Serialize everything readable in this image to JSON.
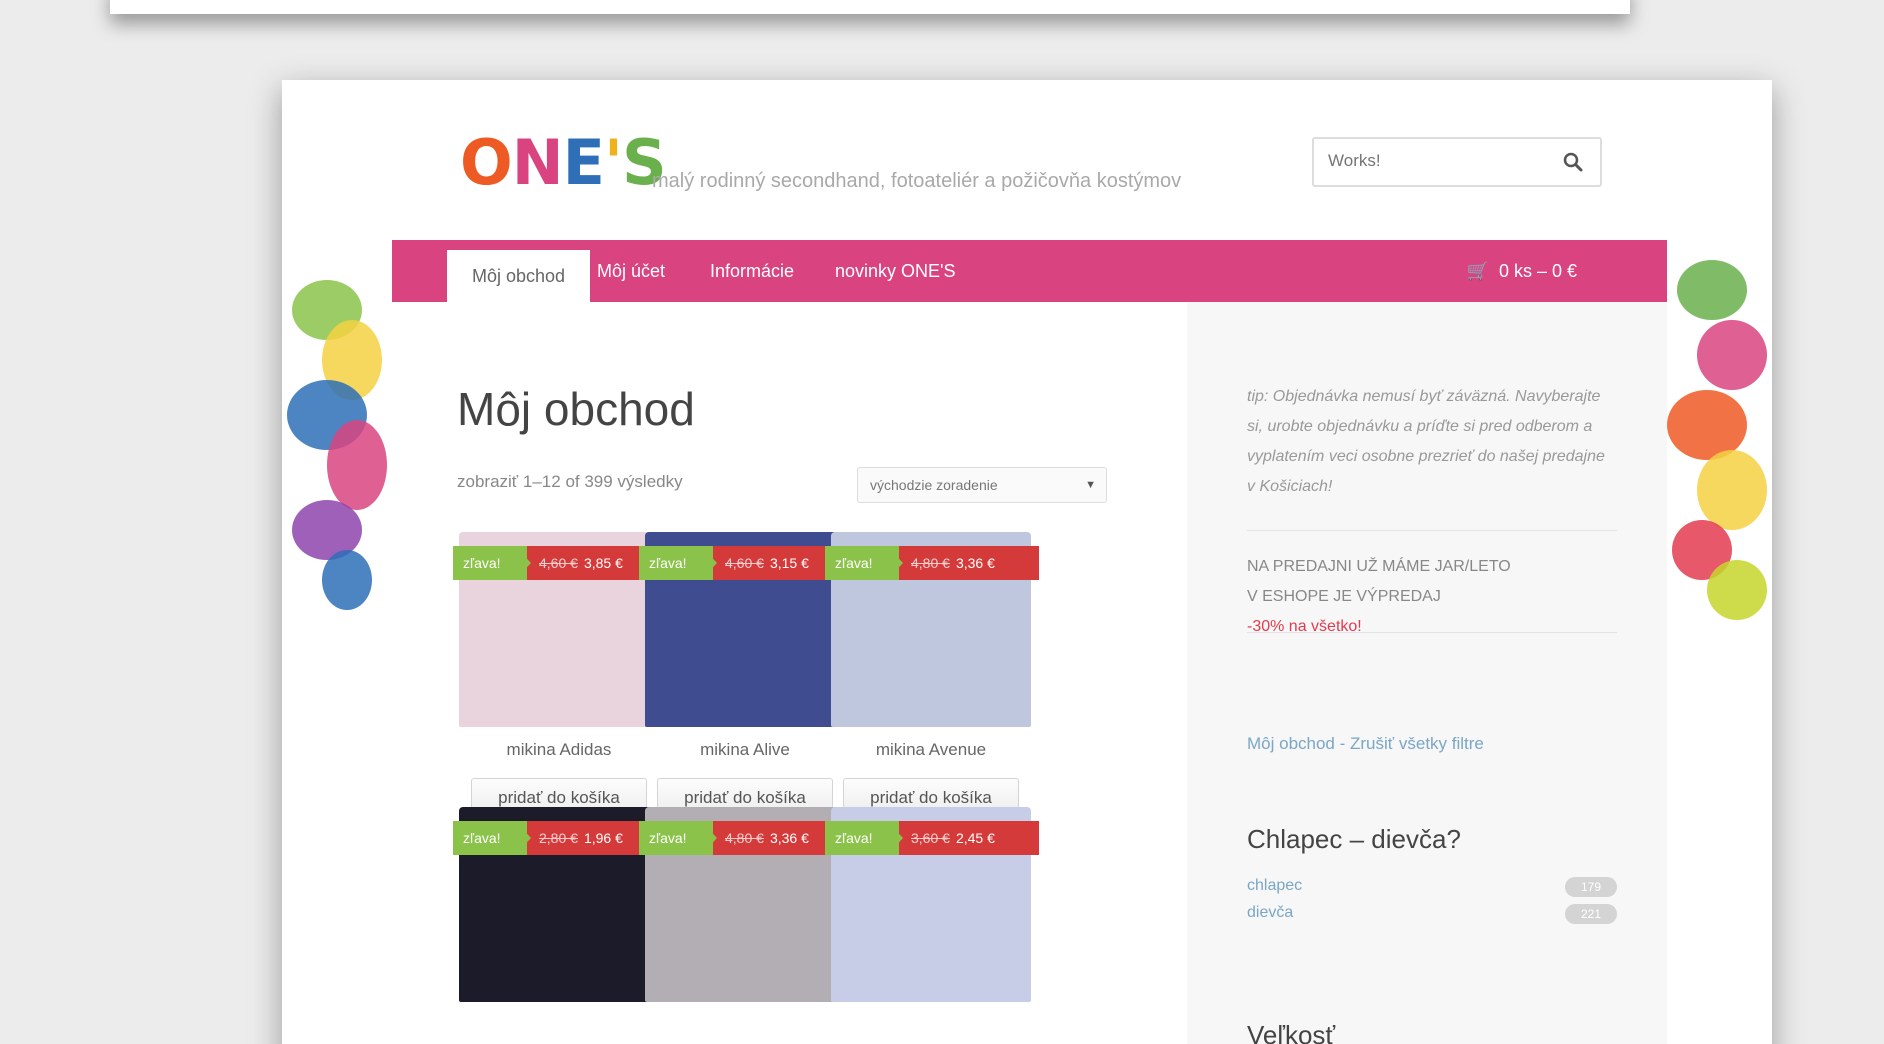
{
  "header": {
    "logo_letters": [
      {
        "ch": "O",
        "color": "#ee5a24"
      },
      {
        "ch": "N",
        "color": "#d94480"
      },
      {
        "ch": "E",
        "color": "#2e6fb7"
      },
      {
        "ch": "'",
        "color": "#f0b21b"
      },
      {
        "ch": "S",
        "color": "#6ab04c"
      }
    ],
    "tagline": "malý rodinný secondhand, fotoateliér a požičovňa kostýmov",
    "search_placeholder": "Works!"
  },
  "nav": {
    "tabs": [
      {
        "label": "Môj obchod",
        "active": true
      },
      {
        "label": "Môj účet",
        "active": false
      },
      {
        "label": "Informácie",
        "active": false
      },
      {
        "label": "novinky ONE'S",
        "active": false
      }
    ],
    "cart": "0 ks – 0 €"
  },
  "shop": {
    "title": "Môj obchod",
    "result_count": "zobraziť 1–12 of 399 výsledky",
    "sort_selected": "východzie zoradenie"
  },
  "products": [
    {
      "badge": "zľava!",
      "old_price": "4,60 €",
      "price": "3,85 €",
      "name": "mikina Adidas",
      "button": "pridať do košíka",
      "color": "#e9d3dc"
    },
    {
      "badge": "zľava!",
      "old_price": "4,60 €",
      "price": "3,15 €",
      "name": "mikina Alive",
      "button": "pridať do košíka",
      "color": "#3f4c8f"
    },
    {
      "badge": "zľava!",
      "old_price": "4,80 €",
      "price": "3,36 €",
      "name": "mikina Avenue",
      "button": "pridať do košíka",
      "color": "#bfc7de"
    },
    {
      "badge": "zľava!",
      "old_price": "2,80 €",
      "price": "1,96 €",
      "name": "",
      "button": "",
      "color": "#1b1b2a"
    },
    {
      "badge": "zľava!",
      "old_price": "4,80 €",
      "price": "3,36 €",
      "name": "",
      "button": "",
      "color": "#b3aeb3"
    },
    {
      "badge": "zľava!",
      "old_price": "3,60 €",
      "price": "2,45 €",
      "name": "",
      "button": "",
      "color": "#c7cde7"
    }
  ],
  "sidebar": {
    "tip": "tip: Objednávka nemusí byť záväzná. Navyberajte si, urobte objednávku a príďte si pred odberom a vyplatením veci osobne prezrieť do našej predajne v Košiciach!",
    "notice_line1": "NA PREDAJNI UŽ MÁME JAR/LETO",
    "notice_line2": "V ESHOPE JE VÝPREDAJ",
    "notice_sale": "-30% na všetko!",
    "filters_link": "Môj obchod - Zrušiť všetky filtre",
    "filter_title": "Chlapec – dievča?",
    "filter_items": [
      {
        "label": "chlapec",
        "count": "179"
      },
      {
        "label": "dievča",
        "count": "221"
      }
    ],
    "size_title": "Veľkosť"
  }
}
